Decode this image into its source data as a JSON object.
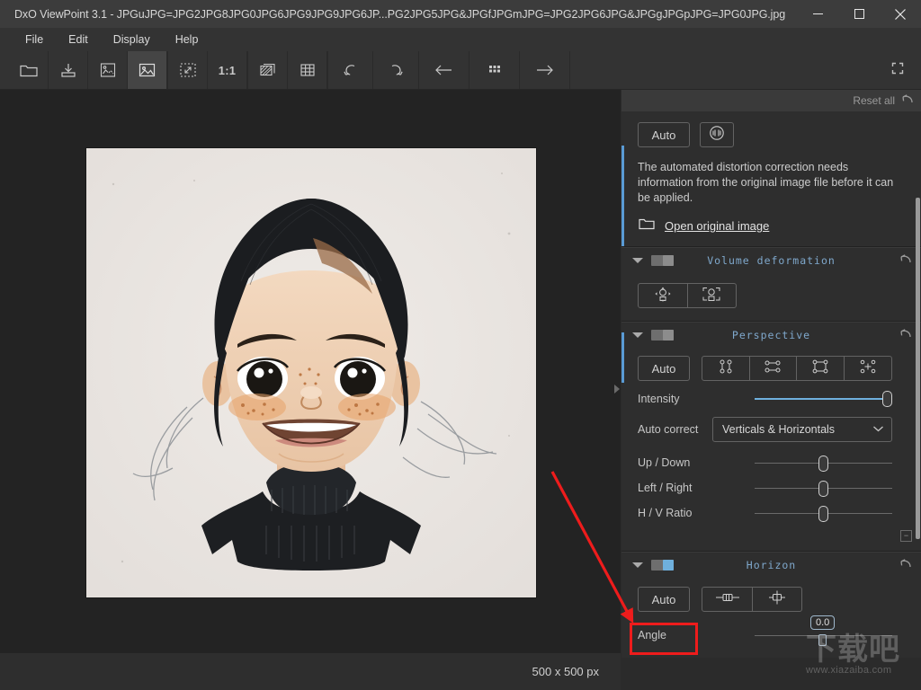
{
  "window": {
    "title": "DxO ViewPoint 3.1 - JPGuJPG=JPG2JPG8JPG0JPG6JPG9JPG9JPG6JP...PG2JPG5JPG&JPGfJPGmJPG=JPG2JPG6JPG&JPGgJPGpJPG=JPG0JPG.jpg",
    "minimize_label": "minimize-icon",
    "maximize_label": "maximize-icon",
    "close_label": "close-icon"
  },
  "menubar": {
    "items": [
      {
        "label": "File"
      },
      {
        "label": "Edit"
      },
      {
        "label": "Display"
      },
      {
        "label": "Help"
      }
    ]
  },
  "toolbar": {
    "buttons": [
      {
        "name": "open-folder-icon",
        "label": ""
      },
      {
        "name": "save-icon",
        "label": ""
      },
      {
        "name": "compare-before-after-icon",
        "label": ""
      },
      {
        "name": "image-view-icon",
        "label": "",
        "active": true
      },
      {
        "name": "fit-to-screen-icon",
        "label": ""
      },
      {
        "name": "zoom-1-1",
        "label": "1:1"
      },
      {
        "name": "overlay-icon",
        "label": ""
      },
      {
        "name": "grid-icon",
        "label": ""
      },
      {
        "name": "undo-icon",
        "label": ""
      },
      {
        "name": "redo-icon",
        "label": ""
      },
      {
        "name": "previous-image-icon",
        "label": ""
      },
      {
        "name": "thumbnails-icon",
        "label": ""
      },
      {
        "name": "next-image-icon",
        "label": ""
      }
    ],
    "fullscreen": "fullscreen-icon"
  },
  "statusbar": {
    "dimensions": "500 x 500 px"
  },
  "panel": {
    "reset_all": "Reset all",
    "distortion": {
      "auto_label": "Auto",
      "tool_icon": "lens-distortion-icon",
      "info_text": "The automated distortion correction needs information from the original image file before it can be applied.",
      "open_link": "Open original image",
      "folder_icon": "open-folder-icon"
    },
    "volume_deformation": {
      "title": "Volume deformation",
      "enabled": false,
      "tools": [
        {
          "name": "volume-deformation-diagonal-icon"
        },
        {
          "name": "volume-deformation-rectangular-icon"
        }
      ]
    },
    "perspective": {
      "title": "Perspective",
      "enabled": false,
      "auto_label": "Auto",
      "tools": [
        {
          "name": "perspective-vertical-icon"
        },
        {
          "name": "perspective-horizontal-icon"
        },
        {
          "name": "perspective-rectangle-icon"
        },
        {
          "name": "perspective-8-points-icon"
        }
      ],
      "intensity_label": "Intensity",
      "intensity_value": 100,
      "auto_correct_label": "Auto correct",
      "auto_correct_value": "Verticals & Horizontals",
      "sliders": [
        {
          "label": "Up / Down",
          "value": 0
        },
        {
          "label": "Left / Right",
          "value": 0
        },
        {
          "label": "H / V Ratio",
          "value": 0
        }
      ],
      "collapse_label": "−"
    },
    "horizon": {
      "title": "Horizon",
      "enabled": true,
      "auto_label": "Auto",
      "tools": [
        {
          "name": "horizon-line-icon"
        },
        {
          "name": "horizon-vertical-icon"
        }
      ],
      "angle_label": "Angle",
      "angle_value": "0.0",
      "collapse_label": "−"
    }
  },
  "colors": {
    "accent": "#5a9bd5",
    "section_title": "#7fa8cc",
    "annotation": "#ee1c1c",
    "panel_bg": "#2e2e2e",
    "canvas_bg": "#232323"
  },
  "watermark": {
    "text_cn": "下载吧",
    "url": "www.xiazaiba.com"
  }
}
